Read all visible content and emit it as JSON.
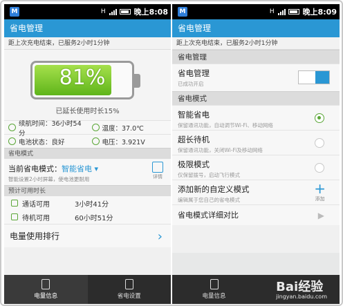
{
  "status_left": {
    "app_icon": "M",
    "signal": "H",
    "time": "晚上8:08"
  },
  "status_right": {
    "app_icon": "M",
    "signal": "H",
    "time": "晚上8:09"
  },
  "left": {
    "title": "省电管理",
    "last_charge": "距上次充电结束，已服务2小时1分钟",
    "battery_percent_text": "81%",
    "battery_level": 0.81,
    "extended": "已延长使用时长15%",
    "stats": [
      {
        "icon": "clock-icon",
        "label": "续航时间：36小时54分"
      },
      {
        "icon": "thermometer-icon",
        "label": "温度：37.0℃"
      },
      {
        "icon": "battery-status-icon",
        "label": "电池状态：良好"
      },
      {
        "icon": "voltage-icon",
        "label": "电压：3.921V"
      }
    ],
    "mode_section": "省电模式",
    "current_mode_label": "当前省电模式：",
    "current_mode_value": "智能省电",
    "mode_desc": "智能设置2小时屏幕，使电池更耐用",
    "detail_label": "详情",
    "estimate_section": "预计可用时长",
    "estimates": [
      {
        "label": "通话可用",
        "value": "3小时41分"
      },
      {
        "label": "待机可用",
        "value": "60小时51分"
      }
    ],
    "rank_label": "电量使用排行"
  },
  "right": {
    "title": "省电管理",
    "last_charge": "距上次充电结束，已服务2小时1分钟",
    "section_manage": "省电管理",
    "manage_title": "省电管理",
    "manage_desc": "已成功开启",
    "section_mode": "省电模式",
    "modes": [
      {
        "title": "智能省电",
        "desc": "保留通讯功能，自动调节Wi-Fi、移动网络",
        "selected": true
      },
      {
        "title": "超长待机",
        "desc": "保留通讯功能，关闭Wi-Fi及移动网络",
        "selected": false
      },
      {
        "title": "极限模式",
        "desc": "仅保留拨号，启动飞行模式",
        "selected": false
      }
    ],
    "custom_title": "添加新的自定义模式",
    "custom_desc": "编辑属于您自己的省电模式",
    "add_label": "添加",
    "compare_label": "省电模式详细对比"
  },
  "tabs": [
    {
      "label": "电量信息",
      "icon": "battery-info-icon"
    },
    {
      "label": "省电设置",
      "icon": "settings-doc-icon"
    },
    {
      "label": "电量信息",
      "icon": "battery-info-icon"
    }
  ],
  "watermark": {
    "brand": "Bai经验",
    "url": "jingyan.baidu.com"
  },
  "colors": {
    "accent": "#2a97d4",
    "battery_green": "#7ccb2e",
    "status_bar": "#000000"
  }
}
